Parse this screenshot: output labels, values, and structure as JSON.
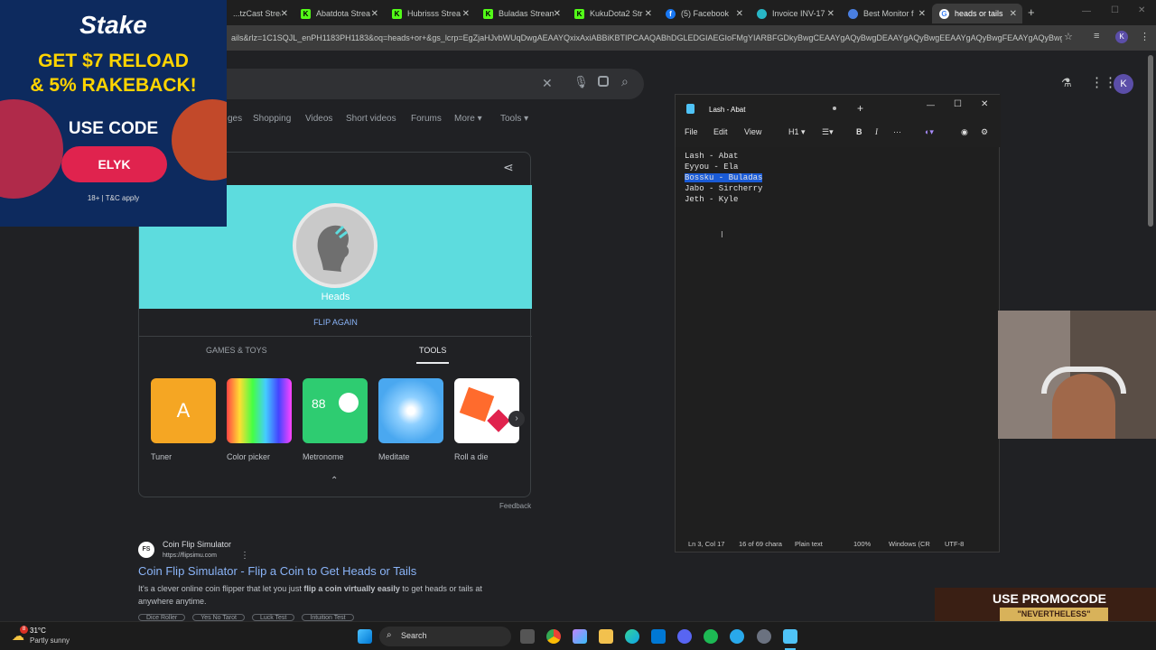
{
  "browser": {
    "tabs": [
      {
        "title": "...tzCast Stream",
        "color": "#53fc18"
      },
      {
        "title": "Abatdota Strea",
        "color": "#53fc18"
      },
      {
        "title": "Hubrisss Strea",
        "color": "#53fc18"
      },
      {
        "title": "Buladas Stream",
        "color": "#53fc18"
      },
      {
        "title": "KukuDota2 Str",
        "color": "#53fc18"
      },
      {
        "title": "(5) Facebook",
        "color": "#1877f2"
      },
      {
        "title": "Invoice INV-17",
        "color": "#28b6c6"
      },
      {
        "title": "Best Monitor f",
        "color": "#4a7fe0"
      },
      {
        "title": "heads or tails",
        "color": "#ffffff"
      }
    ],
    "url": "ails&rlz=1C1SQJL_enPH1183PH1183&oq=heads+or+&gs_lcrp=EgZjaHJvbWUqDwgAEAAYQxixAxiABBiKBTIPCAAQABhDGLEDGIAEGIoFMgYIARBFGDkyBwgCEAAYgAQyBwgDEAAYgAQyBwgEEAAYgAQyBwgFEAAYgAQyBwgGE...",
    "avatar": "K"
  },
  "google": {
    "nav": [
      "ges",
      "Shopping",
      "Videos",
      "Short videos",
      "Forums",
      "More",
      "Tools"
    ],
    "coin_result": "Heads",
    "flip_again": "FLIP AGAIN",
    "section_tabs": [
      "GAMES & TOYS",
      "TOOLS"
    ],
    "tools": [
      {
        "label": "Tuner",
        "color": "#f5a623"
      },
      {
        "label": "Color picker",
        "color": "#ffffff"
      },
      {
        "label": "Metronome",
        "color": "#2ecc71"
      },
      {
        "label": "Meditate",
        "color": "#4aa8f0"
      },
      {
        "label": "Roll a die",
        "color": "#ffffff"
      }
    ],
    "metronome_bpm": "88",
    "feedback": "Feedback",
    "result": {
      "site_name": "Coin Flip Simulator",
      "site_url": "https://flipsimu.com",
      "title": "Coin Flip Simulator - Flip a Coin to Get Heads or Tails",
      "snippet_pre": "It's a clever online coin flipper that let you just ",
      "snippet_bold": "flip a coin virtually easily",
      "snippet_post": " to get heads or tails at anywhere anytime.",
      "chips": [
        "Dice Roller",
        "Yes No Tarot",
        "Luck Test",
        "Intuition Test"
      ]
    }
  },
  "ad": {
    "brand": "Stake",
    "line1": "GET $7 RELOAD",
    "line2": "& 5% RAKEBACK!",
    "use_code": "USE CODE",
    "code": "ELYK",
    "disclaimer": "18+ | T&C apply"
  },
  "notepad": {
    "title": "Lash - Abat",
    "menu": [
      "File",
      "Edit",
      "View",
      "H1"
    ],
    "lines": [
      "Lash - Abat",
      "Eyyou - Ela",
      "Bossku - Buladas",
      "Jabo - Sircherry",
      "Jeth - Kyle"
    ],
    "selected_line": 2,
    "status": {
      "position": "Ln 3, Col 17",
      "chars": "16 of 69 chara",
      "format": "Plain text",
      "zoom": "100%",
      "line_ending": "Windows (CR",
      "encoding": "UTF-8"
    }
  },
  "promo": {
    "line1": "USE PROMOCODE",
    "line2": "\"NEVERTHELESS\""
  },
  "taskbar": {
    "weather_temp": "31°C",
    "weather_desc": "Partly sunny",
    "weather_badge": "8",
    "search": "Search"
  }
}
